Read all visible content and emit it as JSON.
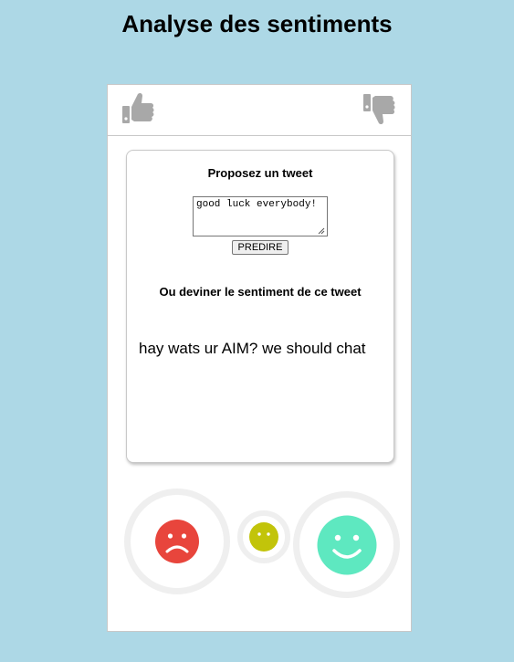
{
  "page": {
    "title": "Analyse des sentiments"
  },
  "toolbar": {
    "thumbs_up_icon": "thumbs-up-icon",
    "thumbs_down_icon": "thumbs-down-icon"
  },
  "card": {
    "propose_heading": "Proposez un tweet",
    "tweet_input_value": "good luck everybody!",
    "predict_label": "PREDIRE",
    "guess_heading": "Ou deviner le sentiment de ce tweet",
    "tweet_text": "hay wats ur AIM? we should chat"
  },
  "sentiments": [
    {
      "name": "negative",
      "icon": "sad-face-icon",
      "color": "#e8453c"
    },
    {
      "name": "neutral",
      "icon": "neutral-face-icon",
      "color": "#c2c40a"
    },
    {
      "name": "positive",
      "icon": "happy-face-icon",
      "color": "#5ee8c0"
    }
  ],
  "colors": {
    "background": "#add8e6",
    "icon_gray": "#a8a8a8",
    "ring_gray": "#efefef"
  }
}
